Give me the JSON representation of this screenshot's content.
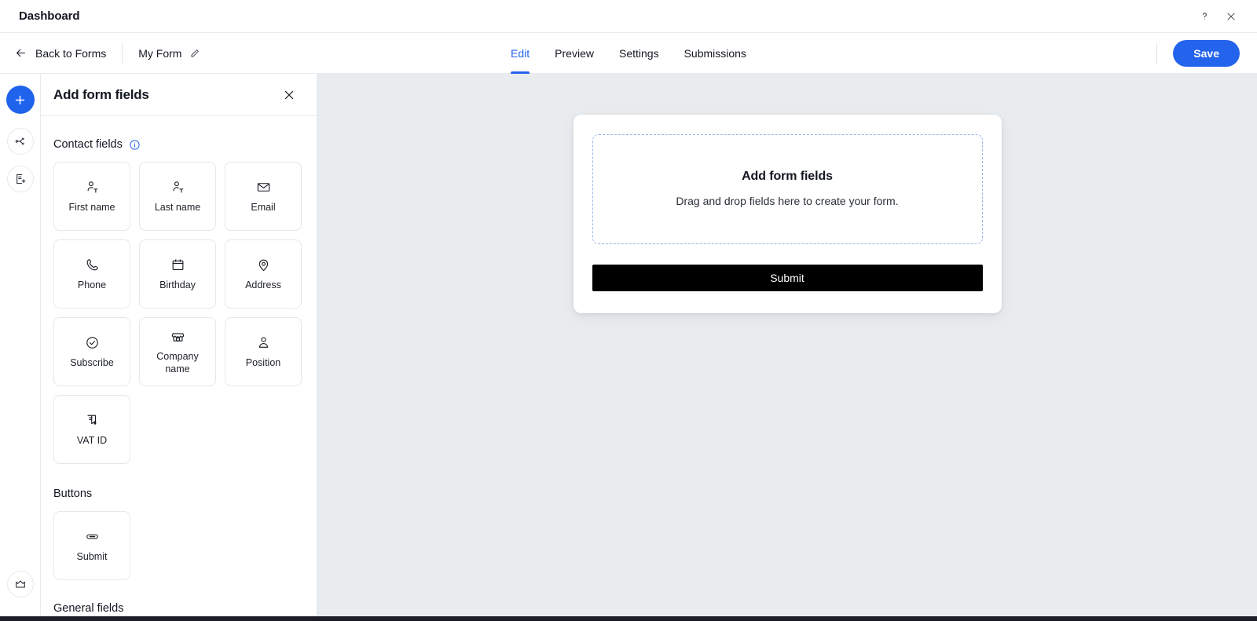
{
  "window": {
    "title": "Dashboard",
    "help_icon": "question-mark-icon",
    "close_icon": "close-icon"
  },
  "topbar": {
    "back_label": "Back to Forms",
    "back_icon": "arrow-left-icon",
    "form_name": "My Form",
    "edit_icon": "pencil-icon",
    "tabs": [
      {
        "label": "Edit",
        "active": true
      },
      {
        "label": "Preview",
        "active": false
      },
      {
        "label": "Settings",
        "active": false
      },
      {
        "label": "Submissions",
        "active": false
      }
    ],
    "save_label": "Save",
    "accent_color": "#2463eb"
  },
  "rail": {
    "add_icon": "plus-icon",
    "add_color": "#1f62eb",
    "items": [
      {
        "icon": "branch-share-icon",
        "name": "rail-item-rules"
      },
      {
        "icon": "add-page-icon",
        "name": "rail-item-add-page"
      }
    ],
    "bottom_icon": "crown-icon"
  },
  "panel": {
    "title": "Add form fields",
    "close_icon": "close-icon",
    "sections": [
      {
        "title": "Contact fields",
        "has_info": true,
        "info_icon": "info-icon",
        "fields": [
          {
            "label": "First name",
            "icon": "person-text-icon"
          },
          {
            "label": "Last name",
            "icon": "person-text-icon"
          },
          {
            "label": "Email",
            "icon": "envelope-icon"
          },
          {
            "label": "Phone",
            "icon": "phone-icon"
          },
          {
            "label": "Birthday",
            "icon": "calendar-icon"
          },
          {
            "label": "Address",
            "icon": "map-pin-icon"
          },
          {
            "label": "Subscribe",
            "icon": "check-circle-icon"
          },
          {
            "label": "Company name",
            "icon": "store-icon"
          },
          {
            "label": "Position",
            "icon": "person-icon"
          },
          {
            "label": "VAT ID",
            "icon": "receipt-dollar-icon"
          }
        ]
      },
      {
        "title": "Buttons",
        "has_info": false,
        "fields": [
          {
            "label": "Submit",
            "icon": "button-pill-icon"
          }
        ]
      },
      {
        "title": "General fields",
        "has_info": false,
        "fields": []
      }
    ]
  },
  "canvas": {
    "dropzone": {
      "title": "Add form fields",
      "subtitle": "Drag and drop fields here to create your form."
    },
    "submit_label": "Submit",
    "submit_bg": "#000000",
    "background": "#e9ecef"
  }
}
